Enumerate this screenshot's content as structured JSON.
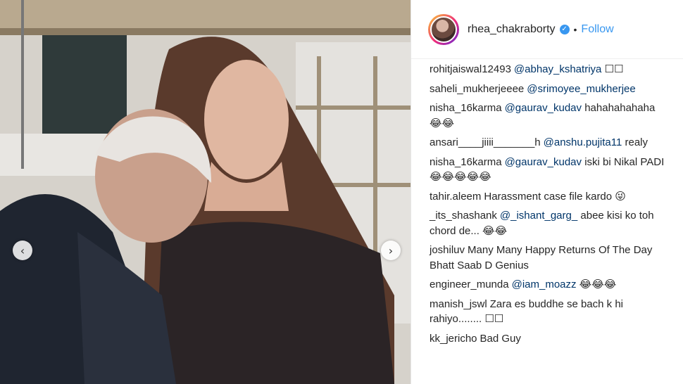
{
  "post": {
    "username": "rhea_chakraborty",
    "follow_label": "Follow",
    "separator": "•",
    "verified_icon": "verified-badge-icon",
    "accent_color": "#3897f0"
  },
  "carousel": {
    "prev_icon": "‹",
    "next_icon": "›"
  },
  "comments": [
    {
      "user": "rohitjaiswal12493",
      "mention": "@abhay_kshatriya",
      "text": " ☐☐"
    },
    {
      "user": "saheli_mukherjeeee",
      "mention": "@srimoyee_mukherjee",
      "text": ""
    },
    {
      "user": "nisha_16karma",
      "mention": "@gaurav_kudav",
      "text": " hahahahahaha 😂😂"
    },
    {
      "user": "ansari____jiiii_______h",
      "mention": "@anshu.pujita11",
      "text": " realy"
    },
    {
      "user": "nisha_16karma",
      "mention": "@gaurav_kudav",
      "text": " iski bi Nikal PADI😂😂😂😂😂"
    },
    {
      "user": "tahir.aleem",
      "mention": "",
      "text": "Harassment case file kardo 😜"
    },
    {
      "user": "_its_shashank",
      "mention": "@_ishant_garg_",
      "text": " abee kisi ko toh chord de... 😂😂"
    },
    {
      "user": "joshiluv",
      "mention": "",
      "text": "Many Many Happy Returns Of The Day Bhatt Saab D Genius"
    },
    {
      "user": "engineer_munda",
      "mention": "@iam_moazz",
      "text": " 😂😂😂"
    },
    {
      "user": "manish_jswl",
      "mention": "",
      "text": "Zara es buddhe se bach k hi rahiyo........ ☐☐"
    },
    {
      "user": "kk_jericho",
      "mention": "",
      "text": "Bad Guy"
    }
  ]
}
